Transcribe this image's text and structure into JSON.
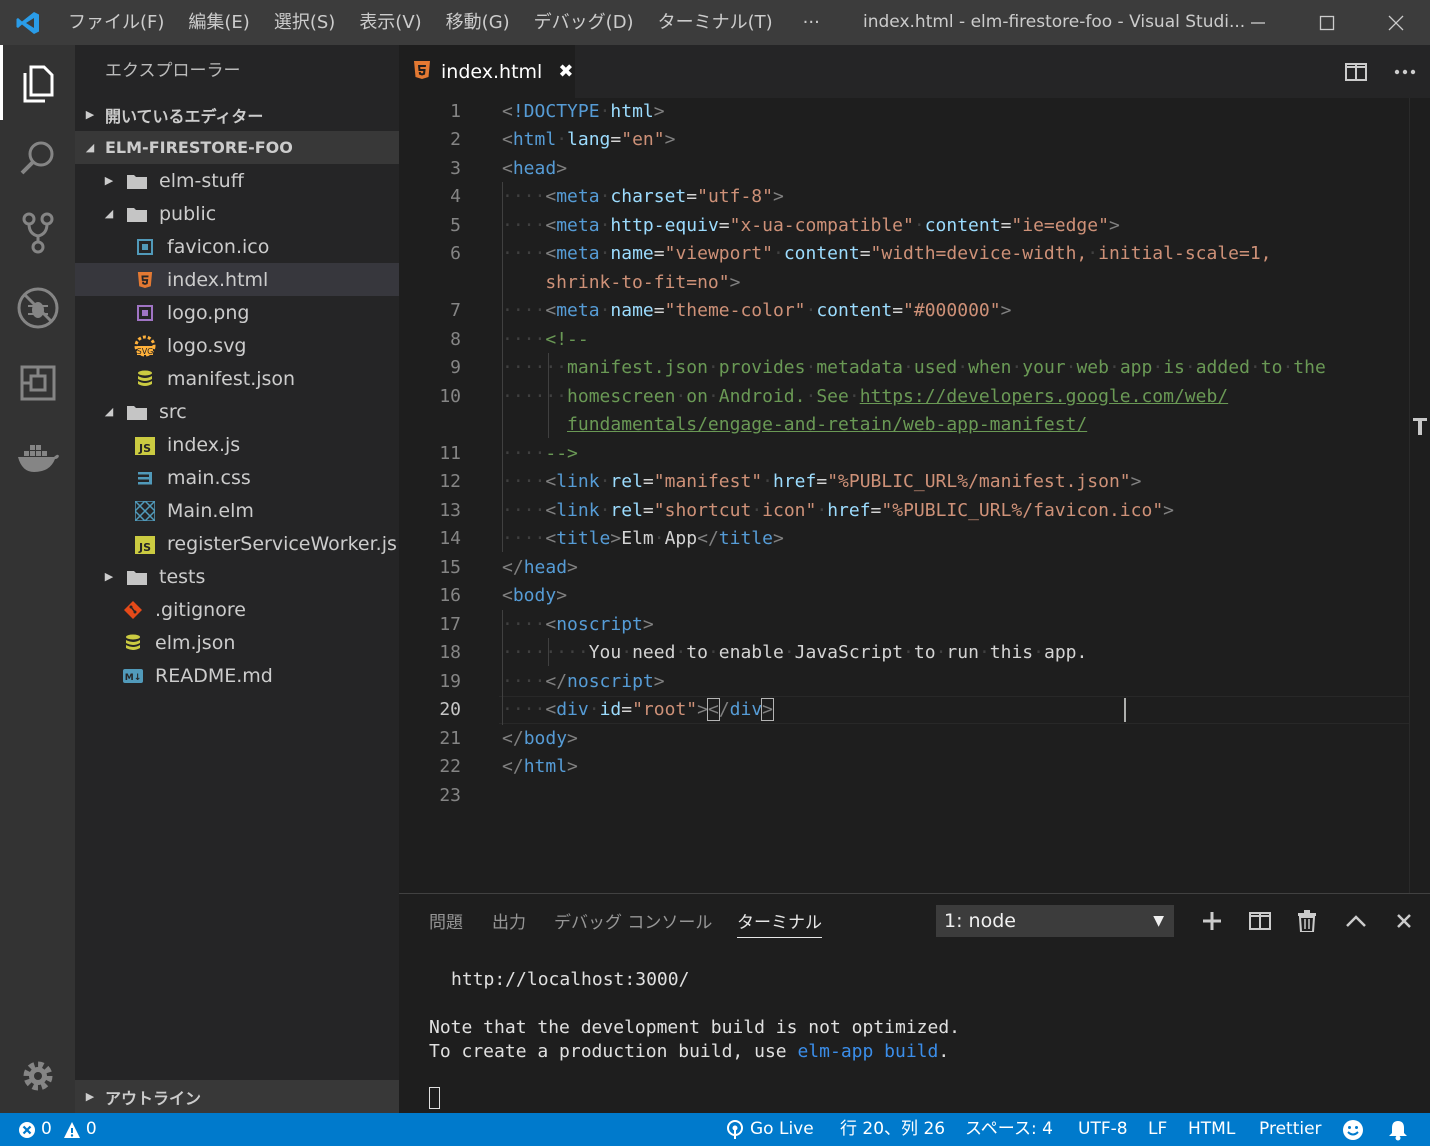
{
  "titlebar": {
    "menu": [
      "ファイル(F)",
      "編集(E)",
      "選択(S)",
      "表示(V)",
      "移動(G)",
      "デバッグ(D)",
      "ターミナル(T)",
      "···"
    ],
    "window_title": "index.html - elm-firestore-foo - Visual Studi..."
  },
  "sidebar": {
    "title": "エクスプローラー",
    "open_editors": "開いているエディター",
    "project": "ELM-FIRESTORE-FOO",
    "outline": "アウトライン",
    "tree": [
      {
        "label": "elm-stuff",
        "type": "folder",
        "expanded": false,
        "depth": 1
      },
      {
        "label": "public",
        "type": "folder",
        "expanded": true,
        "depth": 1
      },
      {
        "label": "favicon.ico",
        "type": "ico",
        "depth": 2
      },
      {
        "label": "index.html",
        "type": "html",
        "depth": 2,
        "selected": true
      },
      {
        "label": "logo.png",
        "type": "png",
        "depth": 2
      },
      {
        "label": "logo.svg",
        "type": "svg",
        "depth": 2
      },
      {
        "label": "manifest.json",
        "type": "json",
        "depth": 2
      },
      {
        "label": "src",
        "type": "folder",
        "expanded": true,
        "depth": 1
      },
      {
        "label": "index.js",
        "type": "js",
        "depth": 2
      },
      {
        "label": "main.css",
        "type": "css",
        "depth": 2
      },
      {
        "label": "Main.elm",
        "type": "elm",
        "depth": 2
      },
      {
        "label": "registerServiceWorker.js",
        "type": "js",
        "depth": 2
      },
      {
        "label": "tests",
        "type": "folder",
        "expanded": false,
        "depth": 1
      },
      {
        "label": ".gitignore",
        "type": "git",
        "depth": 1
      },
      {
        "label": "elm.json",
        "type": "json",
        "depth": 1
      },
      {
        "label": "README.md",
        "type": "md",
        "depth": 1
      }
    ]
  },
  "tab": {
    "label": "index.html",
    "close": "✖"
  },
  "editor": {
    "line_numbers": [
      "1",
      "2",
      "3",
      "4",
      "5",
      "6",
      "",
      "7",
      "8",
      "9",
      "10",
      "",
      "11",
      "12",
      "13",
      "14",
      "15",
      "16",
      "17",
      "18",
      "19",
      "20",
      "21",
      "22",
      "23"
    ],
    "current_line": "20"
  },
  "panel": {
    "tabs": [
      "問題",
      "出力",
      "デバッグ コンソール",
      "ターミナル"
    ],
    "active_tab": "ターミナル",
    "terminal_select": "1: node",
    "terminal_lines": {
      "url": "http://localhost:3000/",
      "note1": "Note that the development build is not optimized.",
      "note2_prefix": "To create a production build, use ",
      "note2_cmd": "elm-app build",
      "note2_suffix": "."
    }
  },
  "statusbar": {
    "errors": "0",
    "warnings": "0",
    "golive": "Go Live",
    "position": "行 20、列 26",
    "spaces": "スペース: 4",
    "encoding": "UTF-8",
    "eol": "LF",
    "language": "HTML",
    "formatter": "Prettier"
  },
  "colors": {
    "accent": "#007acc",
    "tag": "#569cd6",
    "attr": "#9cdcfe",
    "string": "#ce9178",
    "comment": "#6a9955"
  }
}
